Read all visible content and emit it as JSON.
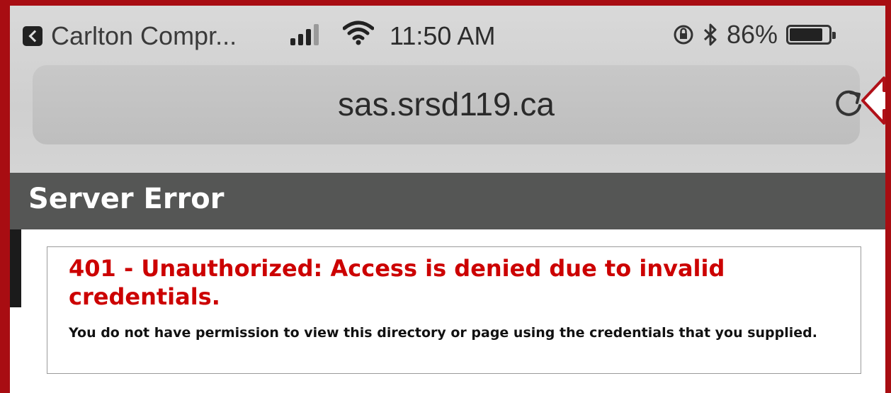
{
  "status_bar": {
    "back_app": "Carlton Compr...",
    "time": "11:50 AM",
    "battery": "86%",
    "battery_level": 0.86
  },
  "address_bar": {
    "url": "sas.srsd119.ca"
  },
  "page": {
    "title": "Server Error",
    "error_heading": "401 - Unauthorized: Access is denied due to invalid credentials.",
    "error_message": "You do not have permission to view this directory or page using the credentials that you supplied."
  },
  "colors": {
    "frame_border": "#a80d12",
    "error_red": "#cc0000",
    "title_bar": "#555655"
  },
  "icons": [
    "back-app-icon",
    "signal-icon",
    "wifi-icon",
    "orientation-lock-icon",
    "bluetooth-icon",
    "battery-icon",
    "reload-icon",
    "annotation-arrow-icon"
  ]
}
